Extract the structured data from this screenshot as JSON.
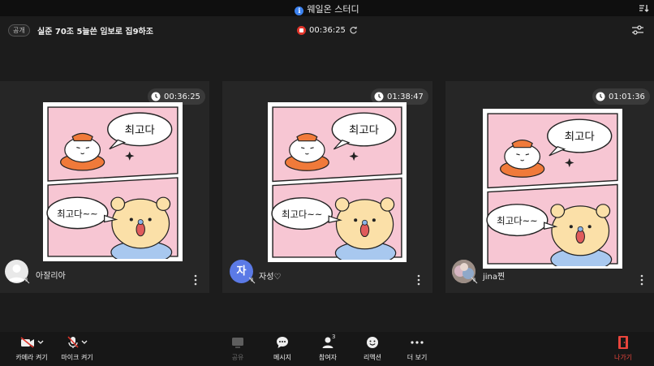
{
  "window": {
    "title": "웨일온 스터디"
  },
  "header": {
    "visibility_badge": "공개",
    "meeting_title": "실준 70조 5늘쓴 임보로 집9하조",
    "elapsed": "00:36:25"
  },
  "participants": [
    {
      "name": "아잘리아",
      "timer": "00:36:25",
      "avatar": "default",
      "mic_muted": true
    },
    {
      "name": "자성♡",
      "timer": "01:38:47",
      "avatar_letter": "자",
      "mic_muted": true
    },
    {
      "name": "jina찐",
      "timer": "01:01:36",
      "avatar": "photo",
      "mic_muted": true
    }
  ],
  "comic": {
    "top_bubble": "최고다",
    "bottom_bubble": "최고다~~"
  },
  "toolbar": {
    "camera": "카메라 켜기",
    "mic": "마이크 켜기",
    "share": "공유",
    "message": "메시지",
    "participants": "참여자",
    "participants_count": "3",
    "reaction": "리액션",
    "more": "더 보기",
    "leave": "나가기"
  },
  "colors": {
    "accent_record": "#e0352b",
    "leave": "#e8453c",
    "avatar_letter_bg": "#5b7ae6",
    "info": "#3c82f0",
    "comic_pink": "#f7c6d3"
  }
}
